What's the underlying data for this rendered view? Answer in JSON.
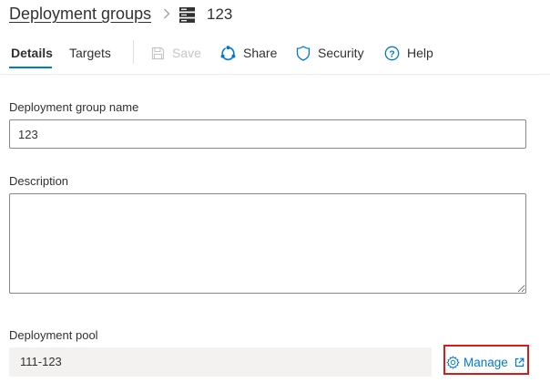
{
  "breadcrumb": {
    "parent_label": "Deployment groups",
    "current_title": "123",
    "separator_icon": "chevron-right-icon",
    "group_icon": "server-icon"
  },
  "tabs": [
    {
      "label": "Details",
      "active": true
    },
    {
      "label": "Targets",
      "active": false
    }
  ],
  "toolbar": {
    "save": {
      "label": "Save",
      "icon": "save-icon",
      "enabled": false
    },
    "share": {
      "label": "Share",
      "icon": "share-icon"
    },
    "security": {
      "label": "Security",
      "icon": "shield-icon"
    },
    "help": {
      "label": "Help",
      "icon": "help-icon"
    }
  },
  "form": {
    "name": {
      "label": "Deployment group name",
      "value": "123"
    },
    "description": {
      "label": "Description",
      "value": ""
    },
    "pool": {
      "label": "Deployment pool",
      "value": "111-123",
      "manage_label": "Manage",
      "manage_icon": "gear-icon",
      "external_icon": "open-in-new-window-icon"
    }
  },
  "colors": {
    "accent": "#0078d4",
    "text": "#323130",
    "disabled": "#c8c6c4",
    "highlight_box": "#d71a1a",
    "readonly_field_bg": "#f3f2f1"
  }
}
